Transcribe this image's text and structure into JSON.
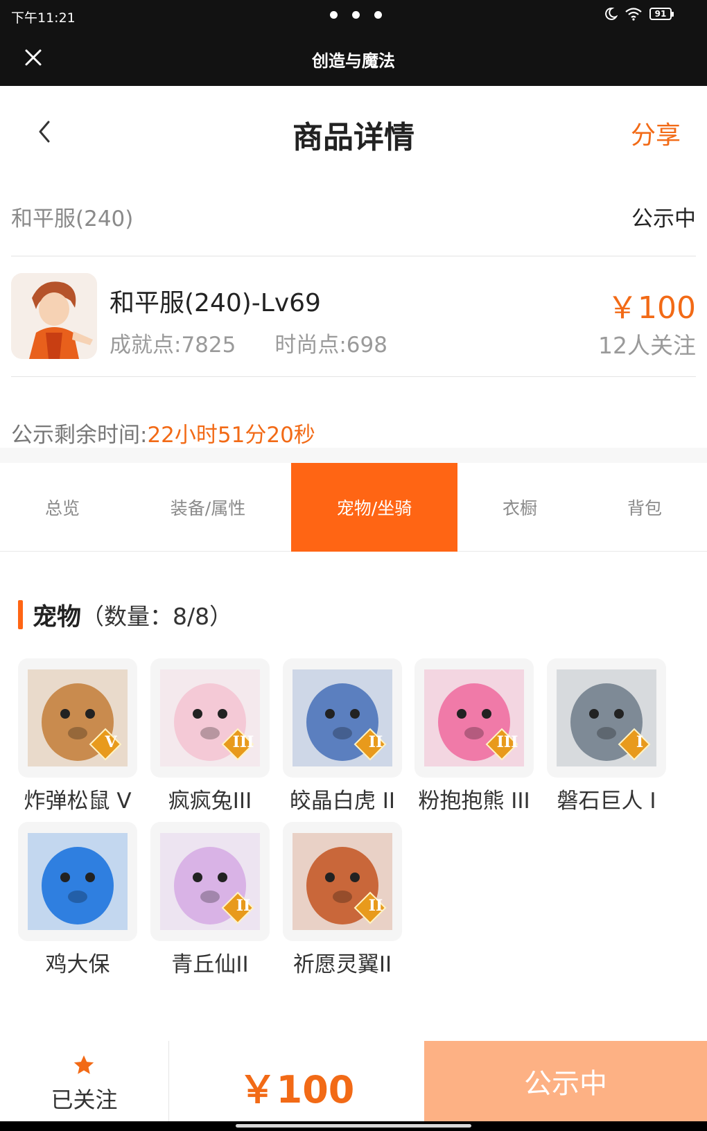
{
  "status_bar": {
    "time": "下午11:21",
    "battery": "91"
  },
  "app": {
    "title": "创造与魔法"
  },
  "header": {
    "title": "商品详情",
    "share_label": "分享"
  },
  "server": {
    "name": "和平服(240)",
    "status": "公示中"
  },
  "item": {
    "name": "和平服(240)-Lv69",
    "achievement": "成就点:7825",
    "fashion": "时尚点:698",
    "price": "￥100",
    "followers": "12人关注"
  },
  "countdown": {
    "label": "公示剩余时间:",
    "value": "22小时51分20秒"
  },
  "tabs": [
    {
      "label": "总览",
      "active": false
    },
    {
      "label": "装备/属性",
      "active": false
    },
    {
      "label": "宠物/坐骑",
      "active": true
    },
    {
      "label": "衣橱",
      "active": false
    },
    {
      "label": "背包",
      "active": false
    }
  ],
  "section": {
    "name": "宠物",
    "count": "（数量：8/8）"
  },
  "pets": [
    {
      "name": "炸弹松鼠 V",
      "rank": "V",
      "color": "#c98b4e"
    },
    {
      "name": "疯疯兔III",
      "rank": "III",
      "color": "#f4c9d6"
    },
    {
      "name": "皎晶白虎 II",
      "rank": "II",
      "color": "#5b7fbf"
    },
    {
      "name": "粉抱抱熊 III",
      "rank": "III",
      "color": "#f07aa8"
    },
    {
      "name": "磐石巨人 I",
      "rank": "I",
      "color": "#7e8a96"
    },
    {
      "name": "鸡大保",
      "rank": "",
      "color": "#2f7fe0"
    },
    {
      "name": "青丘仙II",
      "rank": "II",
      "color": "#d9b3e6"
    },
    {
      "name": "祈愿灵翼II",
      "rank": "II",
      "color": "#c9673a"
    }
  ],
  "bottom": {
    "follow_label": "已关注",
    "price": "￥100",
    "status_button": "公示中"
  },
  "colors": {
    "accent": "#ff6514",
    "price": "#f26a16",
    "disabled_button": "#fdb184"
  }
}
